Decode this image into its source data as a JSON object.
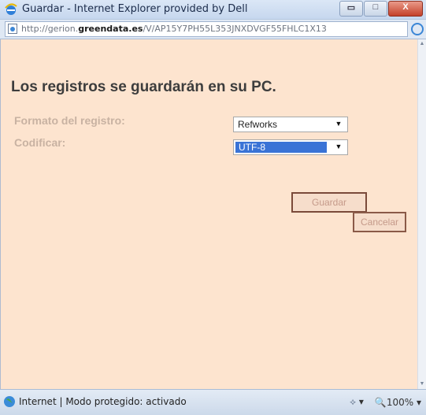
{
  "window": {
    "title": "Guardar - Internet Explorer provided by Dell",
    "minimize_glyph": "▭",
    "maximize_glyph": "□",
    "close_glyph": "X"
  },
  "address": {
    "prefix": "http://gerion.",
    "domain": "greendata.es",
    "rest": "/V/AP15Y7PH55L353JNXDVGF55FHLC1X13"
  },
  "page": {
    "heading": "Los registros se guardarán en su PC.",
    "format_label": "Formato del registro:",
    "format_value": "Refworks",
    "encode_label": "Codificar:",
    "encode_value": "UTF-8",
    "save_button": "Guardar",
    "cancel_button": "Cancelar"
  },
  "status": {
    "zone_text": "Internet | Modo protegido: activado",
    "zoom": "100%",
    "zoom_arrow": "▾",
    "security_arrow": "▾"
  }
}
